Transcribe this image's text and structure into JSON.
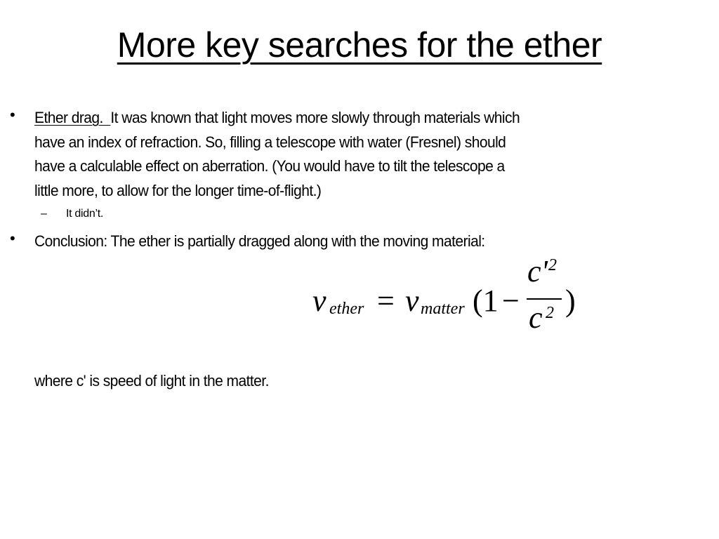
{
  "slide": {
    "title": "More key searches for the ether",
    "bullets": [
      {
        "marker": "•",
        "lead": "Ether drag.  ",
        "lines": [
          "It was known that light moves more slowly through materials which",
          "have an index of refraction.  So, filling a telescope with water (Fresnel) should",
          "have a calculable effect on aberration. (You would have to tilt the telescope a",
          "little more, to allow for the longer time-of-flight.)"
        ],
        "subitems": [
          {
            "marker": "–",
            "text": "It didn’t."
          }
        ]
      },
      {
        "marker": "•",
        "text": "Conclusion:  The ether is partially dragged along with the moving material:"
      }
    ],
    "formula": {
      "lhs_var": "v",
      "lhs_sub": "ether",
      "equals": "=",
      "rhs_var": "v",
      "rhs_sub": "matter",
      "open_paren": "(1",
      "minus": "−",
      "numerator": "c'",
      "numerator_exp": "2",
      "denominator": "c",
      "denominator_exp": "2",
      "close_paren": ")"
    },
    "note": "where c' is speed of light in the matter."
  }
}
